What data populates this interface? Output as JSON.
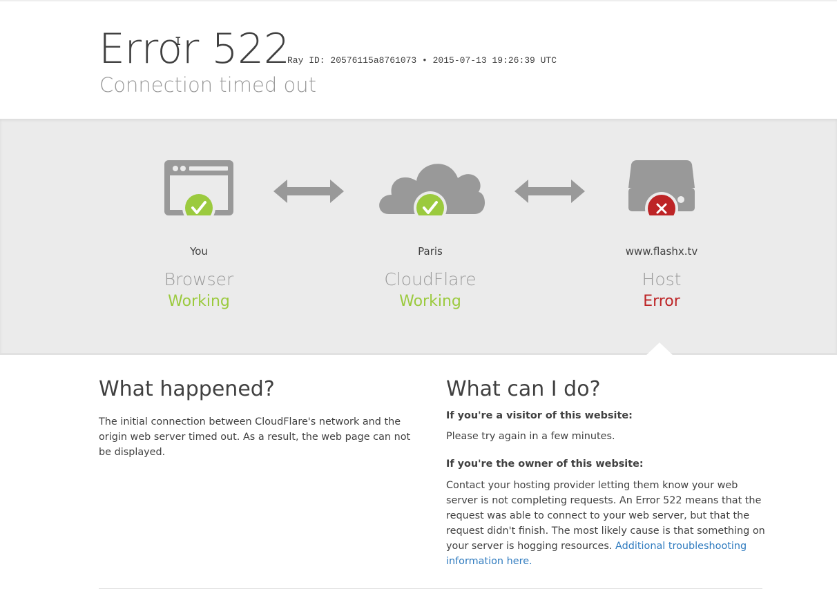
{
  "header": {
    "error_code": "Error 522",
    "ray_id": "Ray ID: 20576115a8761073 • 2015-07-13 19:26:39 UTC",
    "subtitle": "Connection timed out",
    "cursor_glyph": "I"
  },
  "nodes": [
    {
      "location": "You",
      "type": "Browser",
      "status": "Working",
      "status_color": "#9bca3e",
      "icon": "browser-icon",
      "badge": "checkmark-icon"
    },
    {
      "location": "Paris",
      "type": "CloudFlare",
      "status": "Working",
      "status_color": "#9bca3e",
      "icon": "cloud-icon",
      "badge": "checkmark-icon"
    },
    {
      "location": "www.flashx.tv",
      "type": "Host",
      "status": "Error",
      "status_color": "#bd2426",
      "icon": "server-icon",
      "badge": "cross-icon"
    }
  ],
  "colors": {
    "ok": "#9bca3e",
    "error": "#bd2426",
    "icon_gray": "#999999",
    "link": "#2f7bbf"
  },
  "what_happened": {
    "title": "What happened?",
    "text": "The initial connection between CloudFlare's network and the origin web server timed out. As a result, the web page can not be displayed."
  },
  "what_can_i_do": {
    "title": "What can I do?",
    "visitor_heading": "If you're a visitor of this website:",
    "visitor_text": "Please try again in a few minutes.",
    "owner_heading": "If you're the owner of this website:",
    "owner_text": "Contact your hosting provider letting them know your web server is not completing requests. An Error 522 means that the request was able to connect to your web server, but that the request didn't finish. The most likely cause is that something on your server is hogging resources.",
    "owner_link": "Additional troubleshooting information here."
  }
}
